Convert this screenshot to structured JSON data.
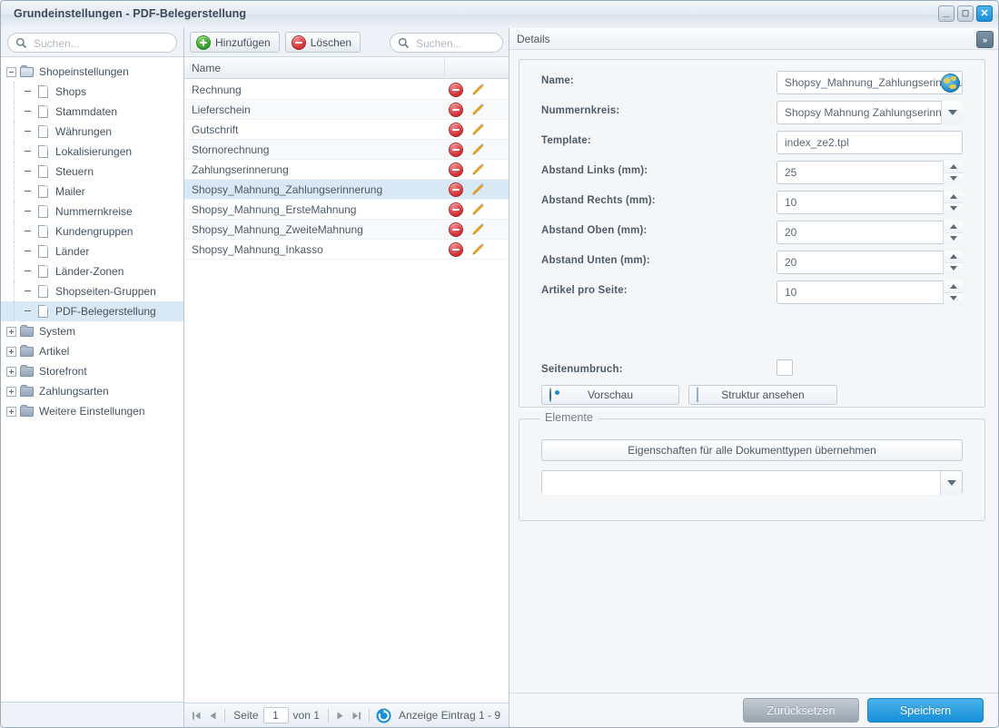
{
  "window": {
    "title": "Grundeinstellungen - PDF-Belegerstellung",
    "minimize_label": "—",
    "maximize_label": "▭",
    "close_label": "✕"
  },
  "sidebar": {
    "search_placeholder": "Suchen...",
    "search_value": "",
    "items": [
      {
        "label": "Shopeinstellungen",
        "type": "folder",
        "state": "expanded",
        "depth": 0,
        "selected": false
      },
      {
        "label": "Shops",
        "type": "doc",
        "state": "leaf",
        "depth": 1,
        "selected": false
      },
      {
        "label": "Stammdaten",
        "type": "doc",
        "state": "leaf",
        "depth": 1,
        "selected": false
      },
      {
        "label": "Währungen",
        "type": "doc",
        "state": "leaf",
        "depth": 1,
        "selected": false
      },
      {
        "label": "Lokalisierungen",
        "type": "doc",
        "state": "leaf",
        "depth": 1,
        "selected": false
      },
      {
        "label": "Steuern",
        "type": "doc",
        "state": "leaf",
        "depth": 1,
        "selected": false
      },
      {
        "label": "Mailer",
        "type": "doc",
        "state": "leaf",
        "depth": 1,
        "selected": false
      },
      {
        "label": "Nummernkreise",
        "type": "doc",
        "state": "leaf",
        "depth": 1,
        "selected": false
      },
      {
        "label": "Kundengruppen",
        "type": "doc",
        "state": "leaf",
        "depth": 1,
        "selected": false
      },
      {
        "label": "Länder",
        "type": "doc",
        "state": "leaf",
        "depth": 1,
        "selected": false
      },
      {
        "label": "Länder-Zonen",
        "type": "doc",
        "state": "leaf",
        "depth": 1,
        "selected": false
      },
      {
        "label": "Shopseiten-Gruppen",
        "type": "doc",
        "state": "leaf",
        "depth": 1,
        "selected": false
      },
      {
        "label": "PDF-Belegerstellung",
        "type": "doc",
        "state": "leaf",
        "depth": 1,
        "selected": true
      },
      {
        "label": "System",
        "type": "folder",
        "state": "collapsed",
        "depth": 0,
        "selected": false
      },
      {
        "label": "Artikel",
        "type": "folder",
        "state": "collapsed",
        "depth": 0,
        "selected": false
      },
      {
        "label": "Storefront",
        "type": "folder",
        "state": "collapsed",
        "depth": 0,
        "selected": false
      },
      {
        "label": "Zahlungsarten",
        "type": "folder",
        "state": "collapsed",
        "depth": 0,
        "selected": false
      },
      {
        "label": "Weitere Einstellungen",
        "type": "folder",
        "state": "collapsed",
        "depth": 0,
        "selected": false
      }
    ]
  },
  "grid": {
    "toolbar": {
      "add_label": "Hinzufügen",
      "delete_label": "Löschen",
      "search_placeholder": "Suchen...",
      "search_value": ""
    },
    "columns": [
      "Name",
      ""
    ],
    "rows": [
      {
        "name": "Rechnung",
        "selected": false
      },
      {
        "name": "Lieferschein",
        "selected": false
      },
      {
        "name": "Gutschrift",
        "selected": false
      },
      {
        "name": "Stornorechnung",
        "selected": false
      },
      {
        "name": "Zahlungserinnerung",
        "selected": false
      },
      {
        "name": "Shopsy_Mahnung_Zahlungserinnerung",
        "selected": true
      },
      {
        "name": "Shopsy_Mahnung_ErsteMahnung",
        "selected": false
      },
      {
        "name": "Shopsy_Mahnung_ZweiteMahnung",
        "selected": false
      },
      {
        "name": "Shopsy_Mahnung_Inkasso",
        "selected": false
      }
    ],
    "pagination": {
      "first_label": "⏮",
      "prev_label": "◀",
      "page_label": "Seite",
      "page_value": "1",
      "of_label": "von 1",
      "next_label": "▶",
      "last_label": "⏭",
      "status": "Anzeige Eintrag 1 - 9"
    }
  },
  "details": {
    "header": "Details",
    "collapse_label": "»",
    "fields": [
      {
        "label": "Name:",
        "value": "Shopsy_Mahnung_Zahlungserinnerung",
        "control": "text-globe"
      },
      {
        "label": "Nummernkreis:",
        "value": "Shopsy Mahnung Zahlungserinnerung",
        "control": "select"
      },
      {
        "label": "Template:",
        "value": "index_ze2.tpl",
        "control": "text"
      },
      {
        "label": "Abstand Links (mm):",
        "value": "25",
        "control": "spinner"
      },
      {
        "label": "Abstand Rechts (mm):",
        "value": "10",
        "control": "spinner"
      },
      {
        "label": "Abstand Oben (mm):",
        "value": "20",
        "control": "spinner"
      },
      {
        "label": "Abstand Unten (mm):",
        "value": "20",
        "control": "spinner"
      },
      {
        "label": "Artikel pro Seite:",
        "value": "10",
        "control": "spinner"
      }
    ],
    "pagebreak": {
      "label": "Seitenumbruch:",
      "checked": false
    },
    "preview_button": "Vorschau",
    "structure_button": "Struktur ansehen",
    "elements": {
      "legend": "Elemente",
      "apply_all_button": "Eigenschaften für alle Dokumenttypen übernehmen",
      "select_value": ""
    },
    "footer": {
      "reset_label": "Zurücksetzen",
      "save_label": "Speichern"
    }
  },
  "colors": {
    "accent_blue": "#1690d8",
    "selection": "#d9e8f5",
    "delete_red": "#cc2f34",
    "add_green": "#2f9a2c",
    "edit_orange": "#e8a415"
  }
}
